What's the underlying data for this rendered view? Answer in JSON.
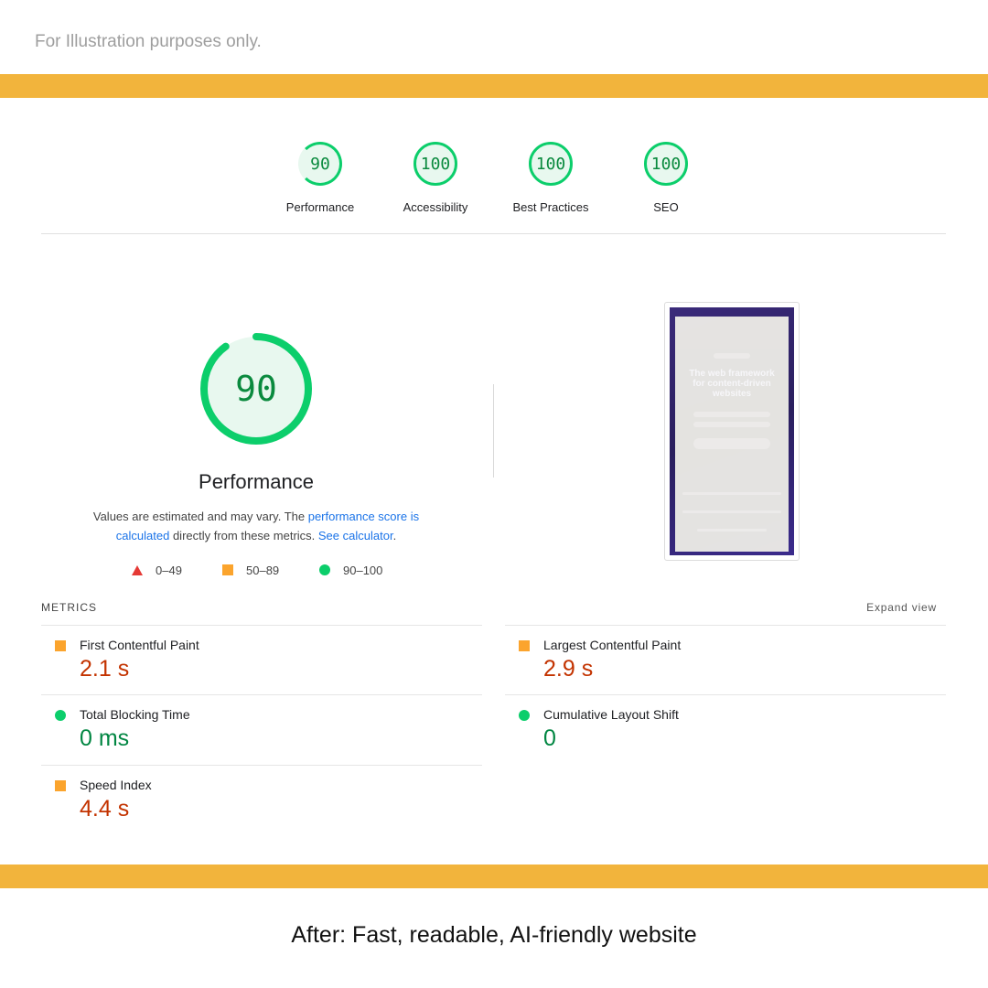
{
  "note": "For Illustration purposes only.",
  "caption": "After: Fast, readable, AI-friendly website",
  "colors": {
    "band": "#f2b43c",
    "pass": "#0cce6b",
    "average": "#fba42d",
    "fail": "#e53935"
  },
  "categories": [
    {
      "score": "90",
      "label": "Performance"
    },
    {
      "score": "100",
      "label": "Accessibility"
    },
    {
      "score": "100",
      "label": "Best Practices"
    },
    {
      "score": "100",
      "label": "SEO"
    }
  ],
  "performance": {
    "score": "90",
    "score_fraction": 0.9,
    "title": "Performance",
    "desc_prefix": "Values are estimated and may vary. The ",
    "link_score": "performance score is calculated",
    "desc_middle": " directly from these metrics. ",
    "link_calculator": "See calculator",
    "desc_suffix": "."
  },
  "legend": [
    {
      "icon": "triangle-icon",
      "range": "0–49"
    },
    {
      "icon": "square-icon",
      "range": "50–89"
    },
    {
      "icon": "circle-icon",
      "range": "90–100"
    }
  ],
  "thumbnail": {
    "headline": "The web framework for content-driven websites"
  },
  "metrics": {
    "heading": "METRICS",
    "expand": "Expand view",
    "items": [
      {
        "label": "First Contentful Paint",
        "value": "2.1 s",
        "rating": "average"
      },
      {
        "label": "Largest Contentful Paint",
        "value": "2.9 s",
        "rating": "average"
      },
      {
        "label": "Total Blocking Time",
        "value": "0 ms",
        "rating": "pass"
      },
      {
        "label": "Cumulative Layout Shift",
        "value": "0",
        "rating": "pass"
      },
      {
        "label": "Speed Index",
        "value": "4.4 s",
        "rating": "average"
      }
    ]
  }
}
